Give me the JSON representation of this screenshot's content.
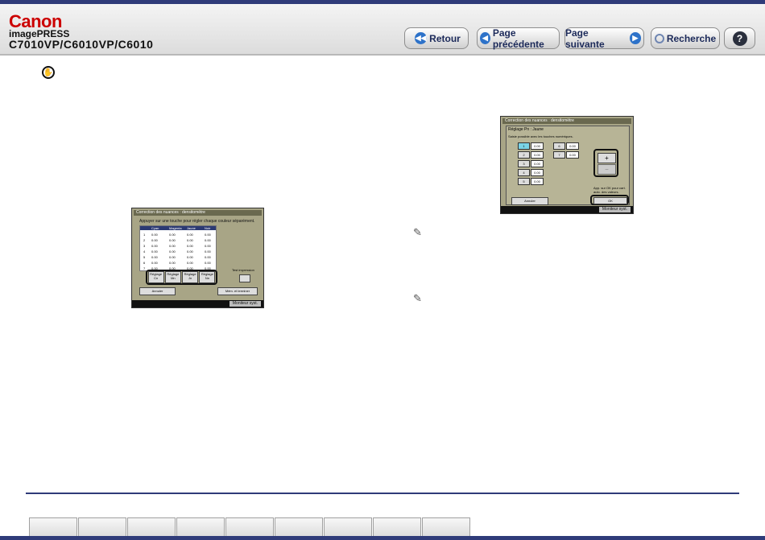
{
  "header": {
    "brand": "Canon",
    "product": "imagePRESS",
    "models": "C7010VP/C6010VP/C6010"
  },
  "nav": {
    "back": "Retour",
    "prev": "Page précédente",
    "next": "Page suivante",
    "search": "Recherche",
    "help": "?"
  },
  "screen1": {
    "title": "Correction des nuances : densitomètre",
    "instruction": "Appuyer sur une touche pour régler chaque couleur séparément.",
    "headers": [
      "Cyan",
      "Magenta",
      "Jaune",
      "Noir"
    ],
    "rows": [
      "1",
      "2",
      "3",
      "4",
      "5",
      "6",
      "7"
    ],
    "value": "0.00",
    "adjust_buttons": [
      "Réglage Cn",
      "Réglage Mn",
      "Réglage Jn",
      "Réglage Nn"
    ],
    "test_print": "Test impression",
    "cancel": "Annuler",
    "memorize": "Mém. et terminer",
    "monitor": "Moniteur syst."
  },
  "screen2": {
    "title": "Correction des nuances : densitomètre",
    "subtitle": "Réglage Pn : Jaune",
    "instruction": "Saisie possible avec les touches numériques.",
    "value": "0.00",
    "left_rows": [
      "1",
      "2",
      "3",
      "4",
      "5"
    ],
    "right_rows": [
      "6",
      "7"
    ],
    "plus": "+",
    "minus": "−",
    "hint": "App. sur OK pour cart. auto. des valeurs.",
    "cancel": "Annuler",
    "ok": "OK",
    "monitor": "Moniteur syst."
  }
}
